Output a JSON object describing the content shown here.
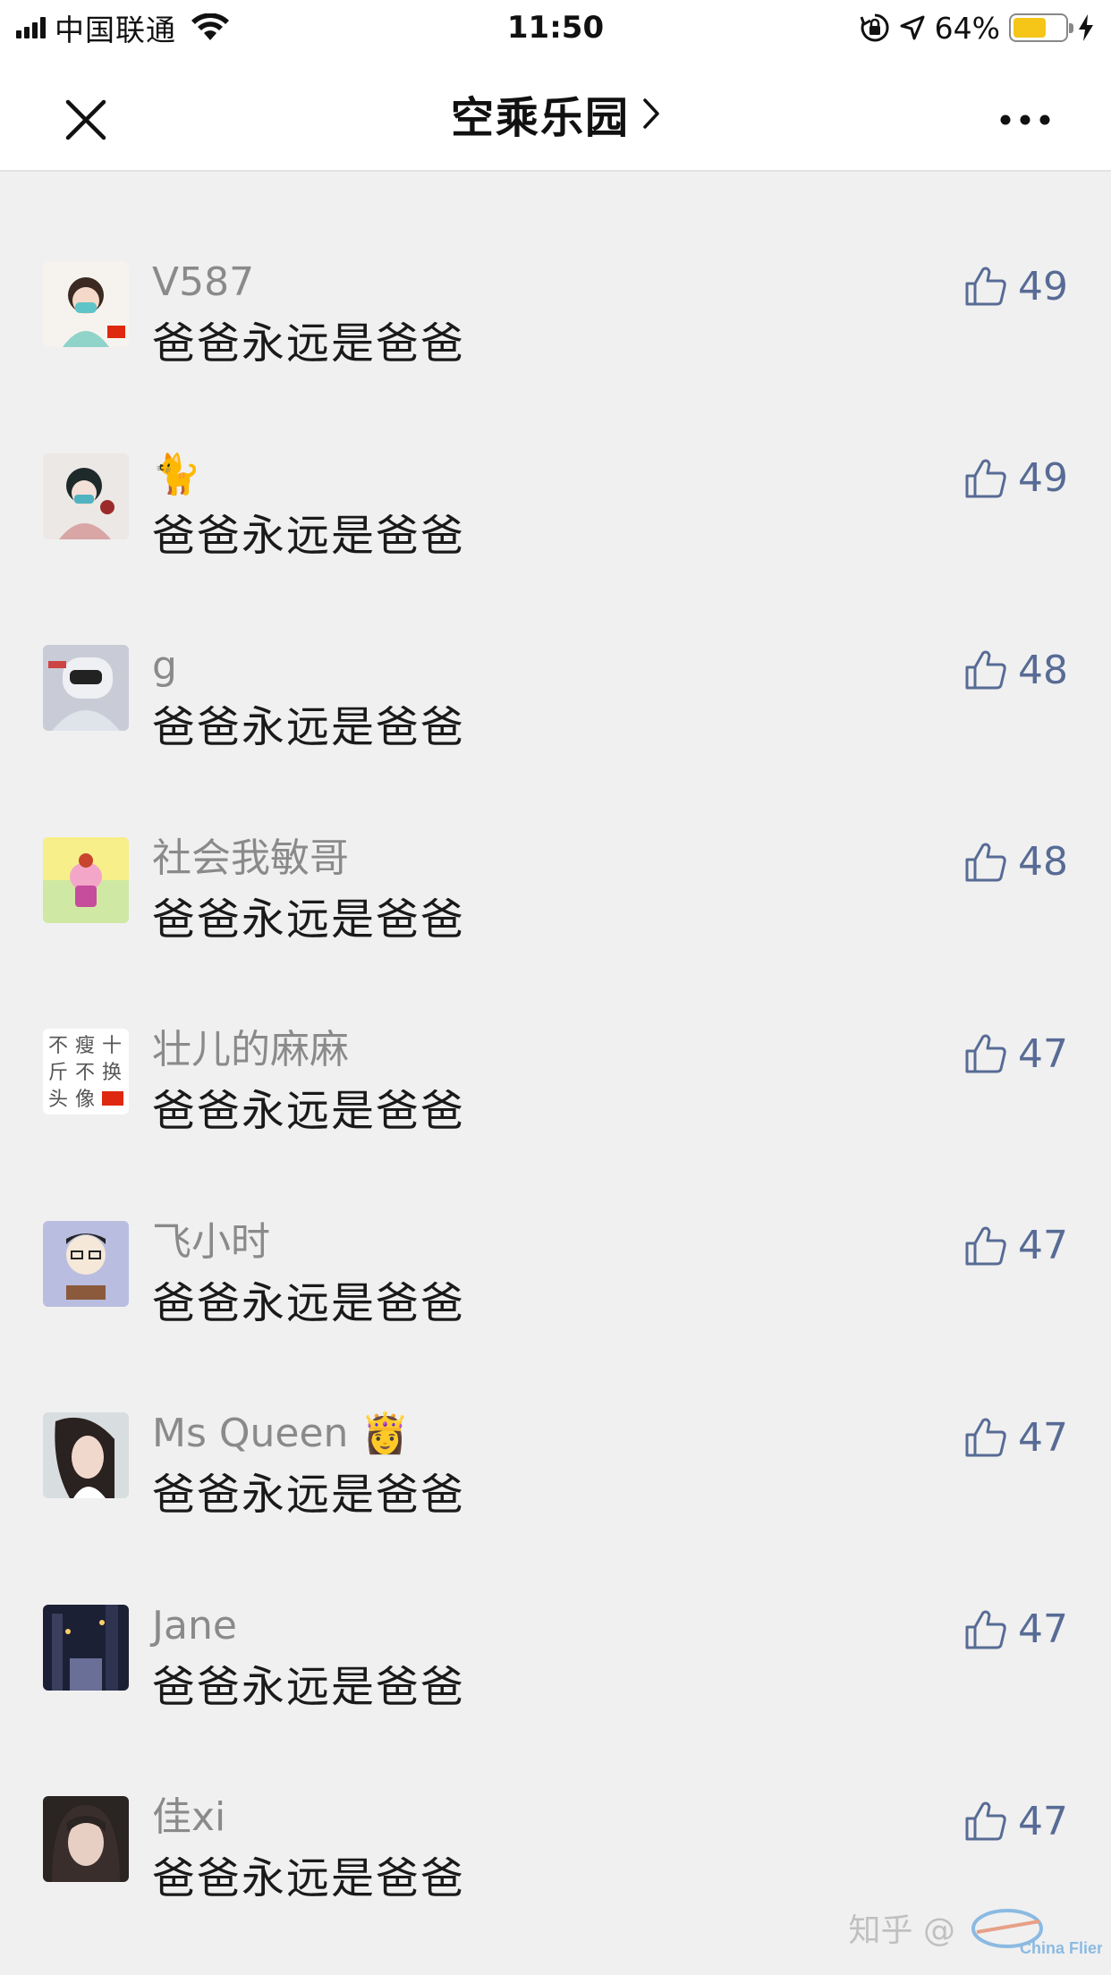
{
  "status_bar": {
    "carrier": "中国联通",
    "time": "11:50",
    "battery_percent": "64%",
    "battery_level": 0.64,
    "battery_color": "#f5c518"
  },
  "nav": {
    "title": "空乘乐园",
    "title_chevron": "chevron-right-icon",
    "close_icon": "close-icon",
    "more_icon": "more-icon"
  },
  "comments": [
    {
      "username": "V587",
      "text": "爸爸永远是爸爸",
      "likes": "49"
    },
    {
      "username": "🐈",
      "text": "爸爸永远是爸爸",
      "likes": "49"
    },
    {
      "username": "g",
      "text": "爸爸永远是爸爸",
      "likes": "48"
    },
    {
      "username": "社会我敏哥",
      "text": "爸爸永远是爸爸",
      "likes": "48"
    },
    {
      "username": "壮儿的麻麻",
      "text": "爸爸永远是爸爸",
      "likes": "47"
    },
    {
      "username": "飞小时",
      "text": "爸爸永远是爸爸",
      "likes": "47"
    },
    {
      "username": "Ms Queen 👸",
      "text": "爸爸永远是爸爸",
      "likes": "47"
    },
    {
      "username": "Jane",
      "text": "爸爸永远是爸爸",
      "likes": "47"
    },
    {
      "username": "佳xi",
      "text": "爸爸永远是爸爸",
      "likes": "47"
    }
  ],
  "colors": {
    "like_color": "#576b95",
    "username_color": "#8a8a8a",
    "background": "#f0f0f0"
  },
  "watermark": {
    "text": "知乎 @",
    "logo_text": "China Flier"
  }
}
